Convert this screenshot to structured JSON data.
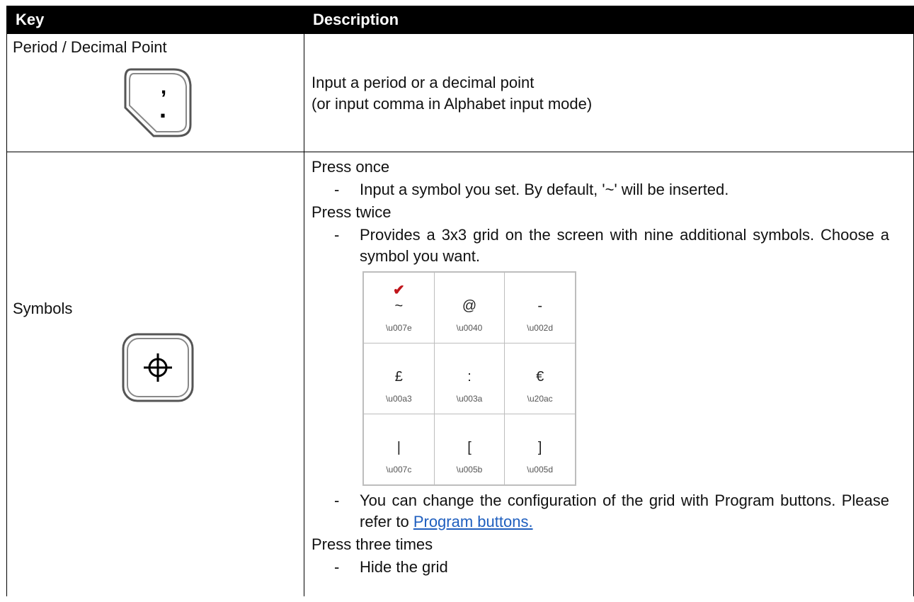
{
  "table": {
    "headers": {
      "key": "Key",
      "description": "Description"
    }
  },
  "rows": [
    {
      "key": "Period / Decimal Point",
      "icon": "period-decimal-key-icon",
      "icon_glyph_top": ",",
      "icon_glyph_bottom": ".",
      "description": [
        "Input a period or a decimal point",
        "(or input comma in Alphabet input mode)"
      ]
    },
    {
      "key": "Symbols",
      "icon": "crosshair-key-icon",
      "press_once": "Press once",
      "press_once_bullet": "Input a symbol you set. By default, '~' will be inserted.",
      "press_twice": "Press twice",
      "press_twice_bullet": "Provides a 3x3 grid on the screen with nine additional symbols. Choose a symbol you want.",
      "grid": [
        [
          {
            "char": "~",
            "code": "\\u007e",
            "checked": true
          },
          {
            "char": "@",
            "code": "\\u0040"
          },
          {
            "char": "-",
            "code": "\\u002d"
          }
        ],
        [
          {
            "char": "£",
            "code": "\\u00a3"
          },
          {
            "char": ":",
            "code": "\\u003a"
          },
          {
            "char": "€",
            "code": "\\u20ac"
          }
        ],
        [
          {
            "char": "|",
            "code": "\\u007c"
          },
          {
            "char": "[",
            "code": "\\u005b"
          },
          {
            "char": "]",
            "code": "\\u005d"
          }
        ]
      ],
      "check_mark": "✔",
      "config_text": "You can change the configuration of the grid with Program buttons. Please refer to ",
      "config_link": "Program buttons.",
      "press_three": "Press three times",
      "press_three_bullet": "Hide the grid"
    }
  ],
  "dash": "-",
  "colors": {
    "header_bg": "#000000",
    "link": "#1f5fbf",
    "check": "#c0151b"
  }
}
